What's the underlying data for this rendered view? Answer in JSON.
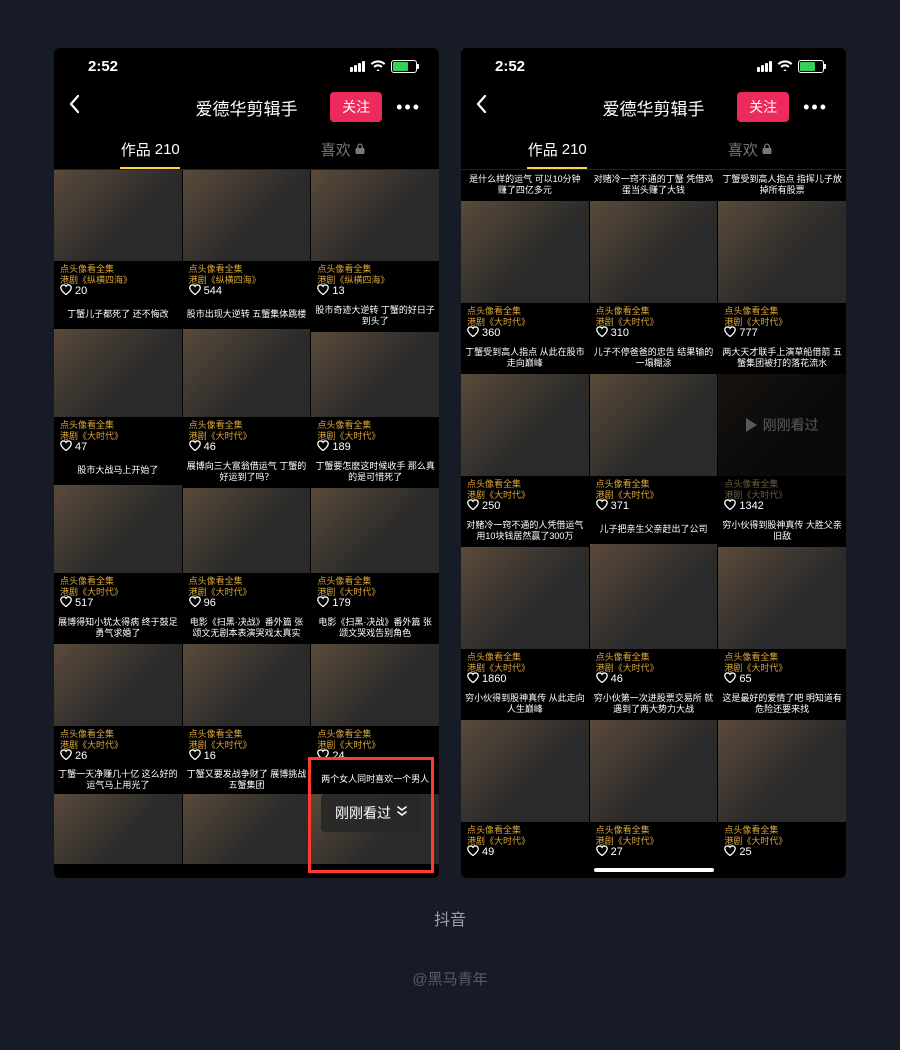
{
  "status": {
    "time": "2:52"
  },
  "nav": {
    "title": "爱德华剪辑手",
    "follow": "关注",
    "more": "•••"
  },
  "tabs": {
    "works_label": "作品",
    "works_count": "210",
    "likes_label": "喜欢"
  },
  "overlay": {
    "recent_pill": "刚刚看过",
    "recent_play": "刚刚看过"
  },
  "footer": {
    "app": "抖音",
    "credit": "@黑马青年"
  },
  "sub": {
    "a": "点头像看全集",
    "b1": "《纵横四海》",
    "b2": "《大时代》"
  },
  "left_grid": [
    [
      {
        "top": "",
        "likes": "20",
        "sub2": "b1",
        "tall": true
      },
      {
        "top": "",
        "likes": "544",
        "sub2": "b1",
        "tall": true
      },
      {
        "top": "",
        "likes": "13",
        "sub2": "b1",
        "tall": true
      }
    ],
    [
      {
        "top": "丁蟹儿子都死了\n还不悔改",
        "likes": "47",
        "sub2": "b2"
      },
      {
        "top": "股市出现大逆转\n五蟹集体跳楼",
        "likes": "46",
        "sub2": "b2"
      },
      {
        "top": "股市奇迹大逆转\n丁蟹的好日子到头了",
        "likes": "189",
        "sub2": "b2"
      }
    ],
    [
      {
        "top": "股市大战马上开始了",
        "likes": "517",
        "sub2": "b2"
      },
      {
        "top": "展博向三大富翁借运气\n丁蟹的好运到了吗？",
        "likes": "96",
        "sub2": "b2"
      },
      {
        "top": "丁蟹要怎麼这时候收手\n那么真的是可惜死了",
        "likes": "179",
        "sub2": "b2"
      }
    ],
    [
      {
        "top": "展博得知小犹太得病\n终于鼓足勇气求婚了",
        "likes": "26",
        "sub2": "b2"
      },
      {
        "top": "电影《扫黑·决战》番外篇\n张颂文无剧本表演哭戏太真实",
        "likes": "16",
        "sub2": "b2"
      },
      {
        "top": "电影《扫黑·决战》番外篇\n张颂文哭戏告别角色",
        "likes": "24",
        "sub2": "b2"
      }
    ],
    [
      {
        "top": "丁蟹一天净赚几十亿\n这么好的运气马上用光了",
        "likes": "",
        "sub2": ""
      },
      {
        "top": "丁蟹又要发战争财了\n展博挑战五蟹集团",
        "likes": "",
        "sub2": ""
      },
      {
        "top": "两个女人同时喜欢一个男人",
        "likes": "",
        "sub2": ""
      }
    ]
  ],
  "right_grid": [
    [
      {
        "top": "是什么样的运气\n可以10分钟赚了四亿多元",
        "likes": "360",
        "sub2": "b2"
      },
      {
        "top": "对赌冷一窍不通的丁蟹\n凭借鸡蛋当头赚了大钱",
        "likes": "310",
        "sub2": "b2"
      },
      {
        "top": "丁蟹受到高人指点\n指挥儿子放掉所有股票",
        "likes": "777",
        "sub2": "b2"
      }
    ],
    [
      {
        "top": "丁蟹受到高人指点\n从此在股市走向巅峰",
        "likes": "250",
        "sub2": "b2"
      },
      {
        "top": "儿子不停爸爸的忠告\n结果输的一塌糊涂",
        "likes": "371",
        "sub2": "b2"
      },
      {
        "top": "两大天才联手上演草船借箭\n五蟹集团被打的落花流水",
        "likes": "1342",
        "sub2": "b2",
        "recent": true
      }
    ],
    [
      {
        "top": "对赌冷一窍不通的人凭借运气\n用10块钱居然赢了300万",
        "likes": "1860",
        "sub2": "b2"
      },
      {
        "top": "儿子把亲生父亲赶出了公司",
        "likes": "46",
        "sub2": "b2"
      },
      {
        "top": "穷小伙得到股神真传\n大胜父亲旧敌",
        "likes": "65",
        "sub2": "b2"
      }
    ],
    [
      {
        "top": "穷小伙得到股神真传\n从此走向人生巅峰",
        "likes": "49",
        "sub2": "b2"
      },
      {
        "top": "穷小伙第一次进股票交易所\n就遇到了两大势力大战",
        "likes": "27",
        "sub2": "b2"
      },
      {
        "top": "这是最好的爱情了吧\n明知道有危险还要来找",
        "likes": "25",
        "sub2": "b2"
      }
    ]
  ]
}
